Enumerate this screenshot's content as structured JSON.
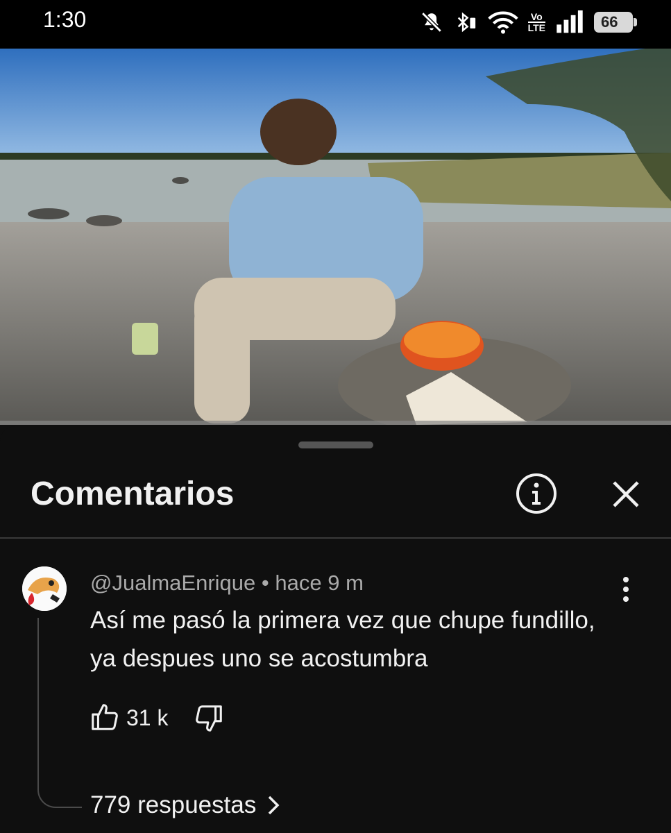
{
  "status_bar": {
    "time": "1:30",
    "icons": [
      "bell-off-icon",
      "bluetooth-icon",
      "wifi-icon",
      "volte-icon",
      "signal-icon",
      "battery-icon"
    ],
    "volte_top": "Vo",
    "volte_bottom": "LTE",
    "battery": "66"
  },
  "video": {
    "description_colors": {
      "sky": "#4a86c9",
      "water": "#a9b3b3",
      "ground": "#6e6e6c"
    }
  },
  "comments_panel": {
    "title": "Comentarios",
    "info_icon": "info-icon",
    "close_icon": "close-icon"
  },
  "comment": {
    "author": "@JualmaEnrique",
    "separator": "•",
    "time": "hace 9 m",
    "text": "Así me pasó la primera vez que chupe fundillo, ya despues uno se acostumbra",
    "likes": "31 k",
    "replies": "779 respuestas"
  },
  "colors": {
    "background": "#0f0f0f",
    "text_primary": "#f1f1f1",
    "text_secondary": "#aaaaaa"
  }
}
